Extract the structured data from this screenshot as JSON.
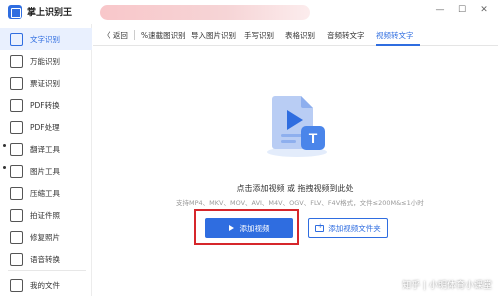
{
  "app": {
    "title": "掌上识别王"
  },
  "window_controls": {
    "minimize": "—",
    "maximize": "☐",
    "close": "✕"
  },
  "sidebar": {
    "items": [
      {
        "label": "文字识别",
        "icon": "text-scan-icon",
        "active": true
      },
      {
        "label": "万能识别",
        "icon": "scan-icon"
      },
      {
        "label": "票证识别",
        "icon": "ticket-icon"
      },
      {
        "label": "PDF转换",
        "icon": "pdf-convert-icon"
      },
      {
        "label": "PDF处理",
        "icon": "pdf-process-icon"
      },
      {
        "label": "翻译工具",
        "icon": "translate-icon"
      },
      {
        "label": "图片工具",
        "icon": "image-icon"
      },
      {
        "label": "压缩工具",
        "icon": "compress-icon"
      },
      {
        "label": "拍证件照",
        "icon": "id-photo-icon"
      },
      {
        "label": "修复照片",
        "icon": "repair-photo-icon"
      },
      {
        "label": "语音转换",
        "icon": "voice-icon"
      }
    ],
    "footer": {
      "label": "我的文件",
      "icon": "folder-icon"
    }
  },
  "tabs": {
    "back": "〈 返回",
    "items": [
      "%速截图识别",
      "导入图片识别",
      "手写识别",
      "表格识别",
      "音频转文字",
      "视频转文字"
    ],
    "active_index": 5
  },
  "main": {
    "illustration": "video-to-text-icon",
    "hint": "点击添加视频 或 拖拽视频到此处",
    "formats": "支持MP4、MKV、MOV、AVI、M4V、OGV、FLV、F4V格式，文件≤200M&≤1小时",
    "add_video_button": "添加视频",
    "add_folder_button": "添加视频文件夹"
  },
  "watermark": {
    "text": "知乎 | 小明体育小课堂"
  },
  "colors": {
    "accent": "#2f6de0",
    "highlight_box": "#d6262b"
  }
}
